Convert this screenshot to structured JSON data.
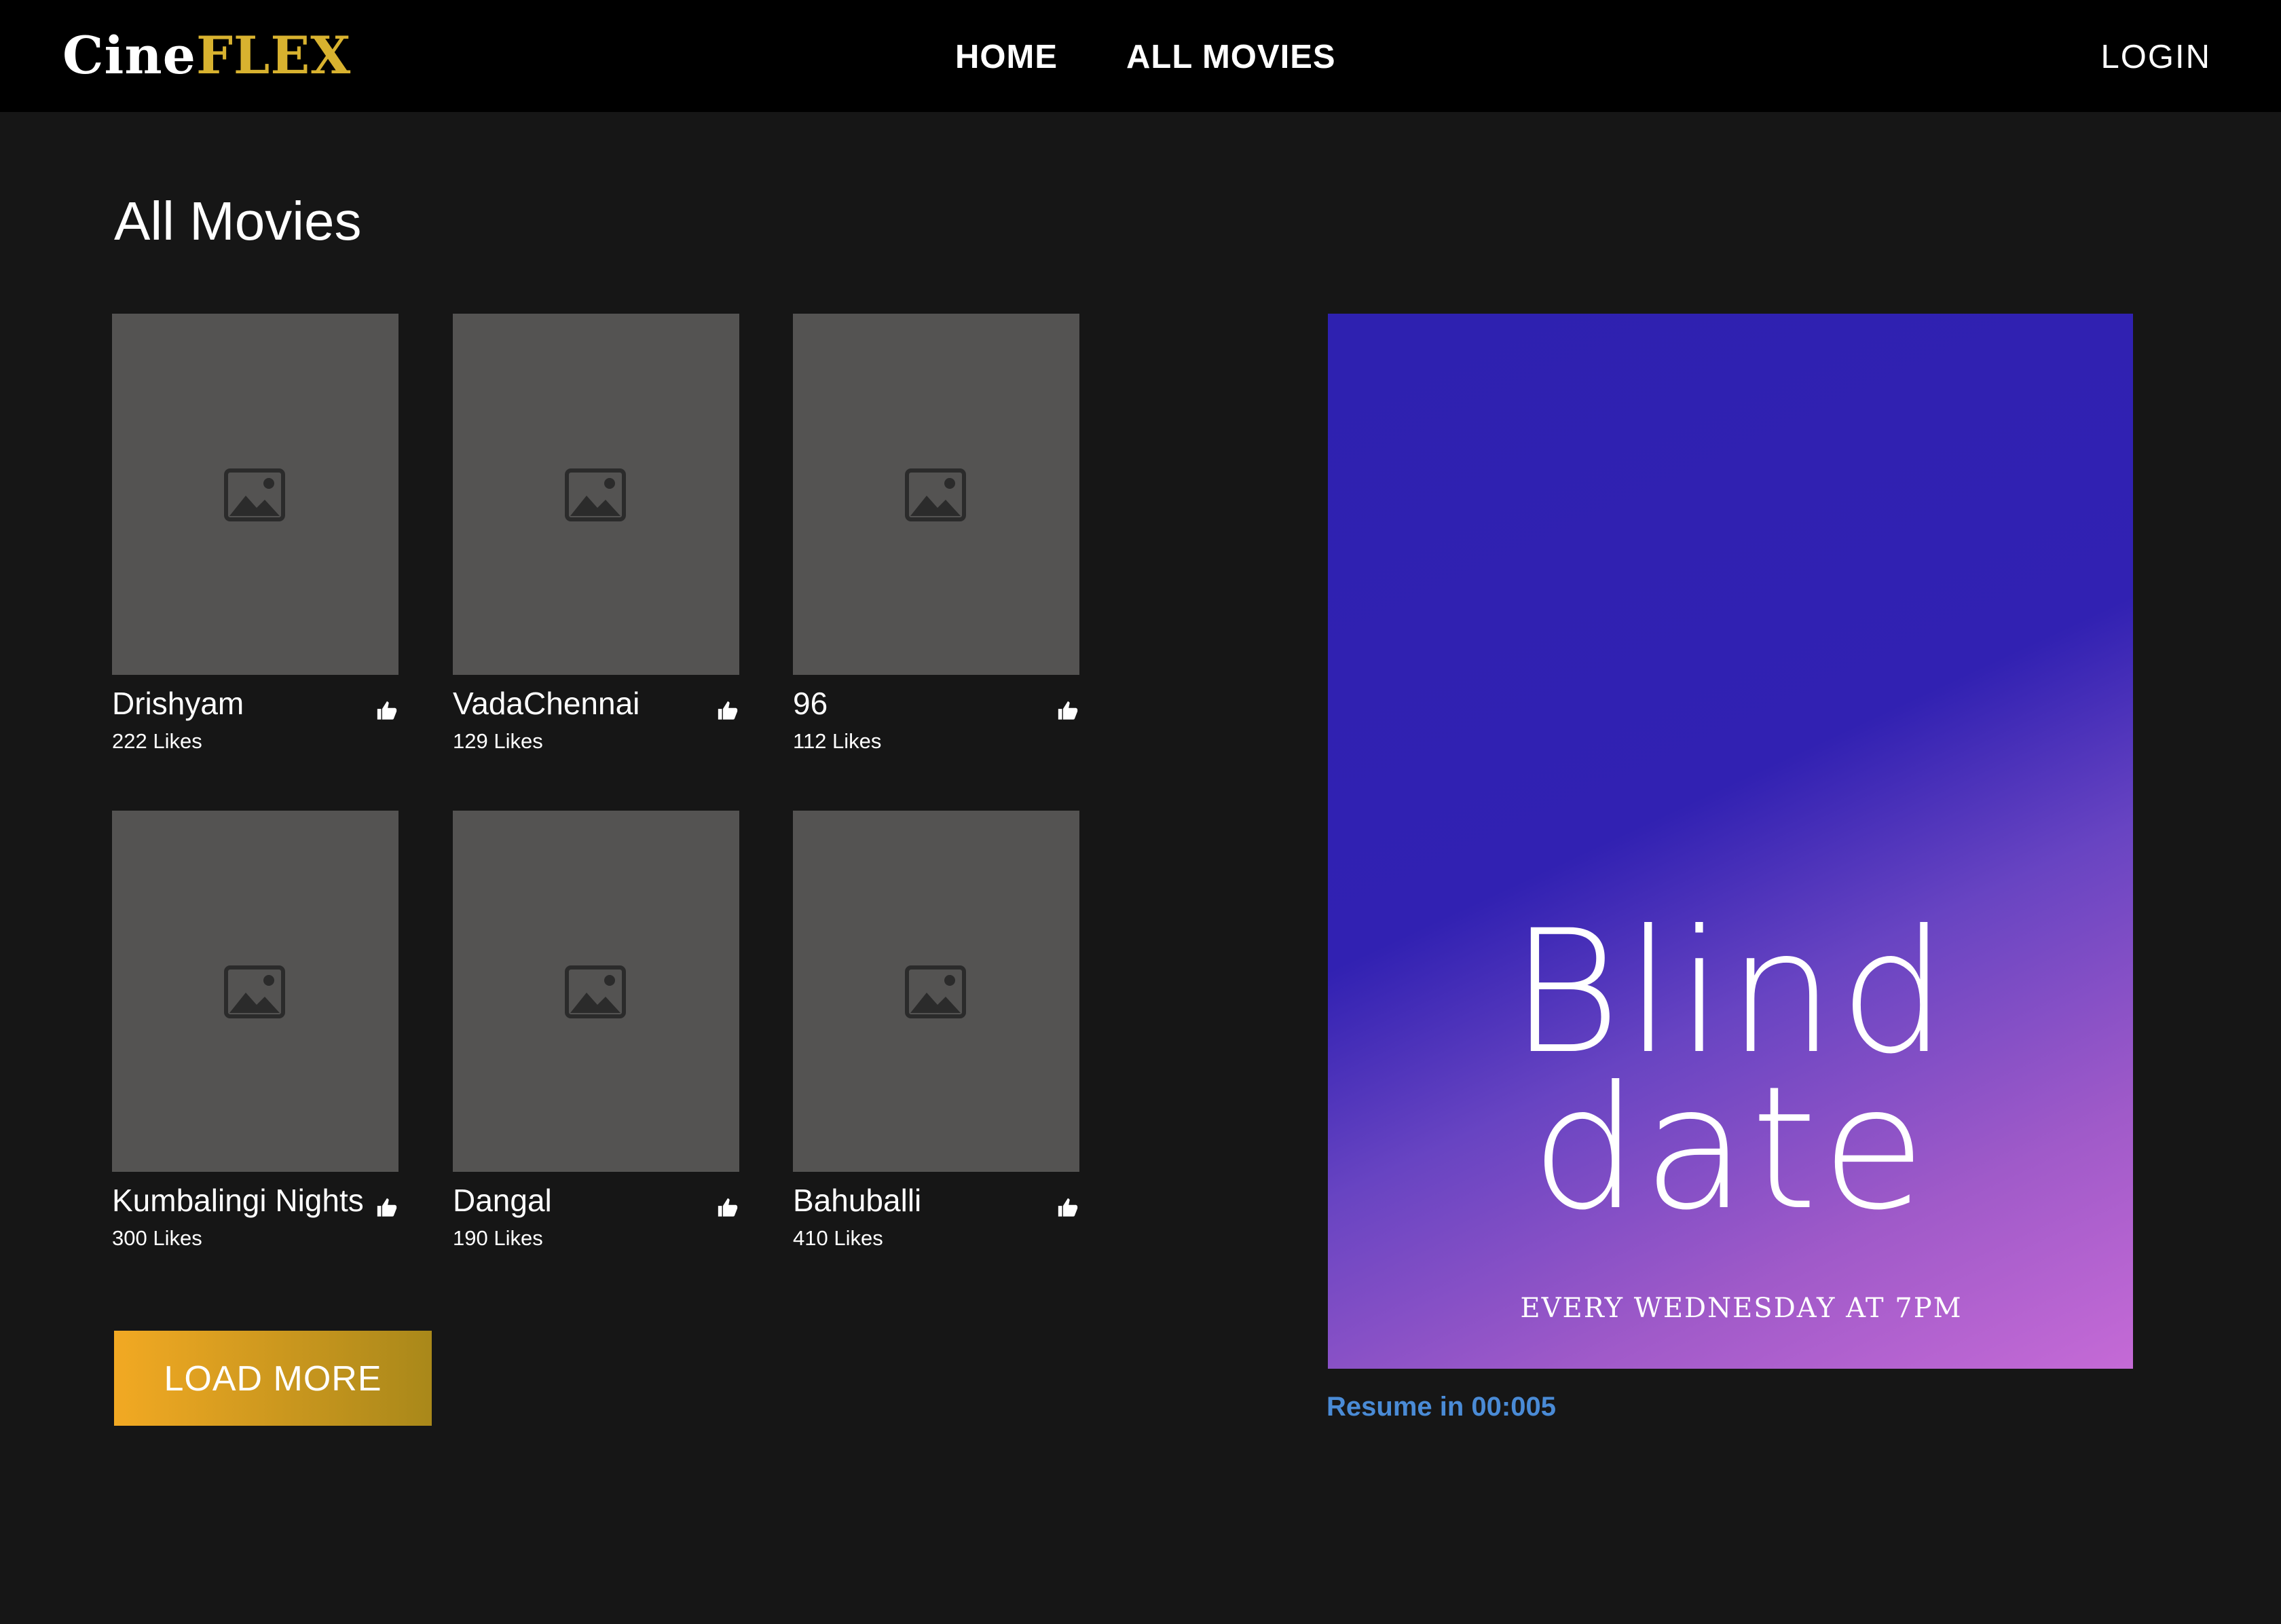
{
  "header": {
    "logo_part1": "Cine",
    "logo_part2": "FLEX",
    "nav": [
      "HOME",
      "ALL MOVIES"
    ],
    "login": "LOGIN"
  },
  "section_title": "All Movies",
  "movies": [
    {
      "title": "Drishyam",
      "likes": "222 Likes"
    },
    {
      "title": "VadaChennai",
      "likes": "129 Likes"
    },
    {
      "title": "96",
      "likes": "112 Likes"
    },
    {
      "title": "Kumbalingi Nights",
      "likes": "300 Likes"
    },
    {
      "title": "Dangal",
      "likes": "190 Likes"
    },
    {
      "title": "Bahuballi",
      "likes": "410 Likes"
    }
  ],
  "load_more": "LOAD MORE",
  "promo": {
    "title_line1": "Blind",
    "title_line2": "date",
    "subtitle": "EVERY WEDNESDAY AT 7PM",
    "resume": "Resume in 00:005"
  },
  "icons": {
    "poster_placeholder": "image-placeholder-icon",
    "like": "thumbs-up-icon"
  },
  "colors": {
    "brand_gold": "#d8b22f",
    "background": "#161616",
    "card": "#545352",
    "resume_link": "#4a8bd6"
  }
}
